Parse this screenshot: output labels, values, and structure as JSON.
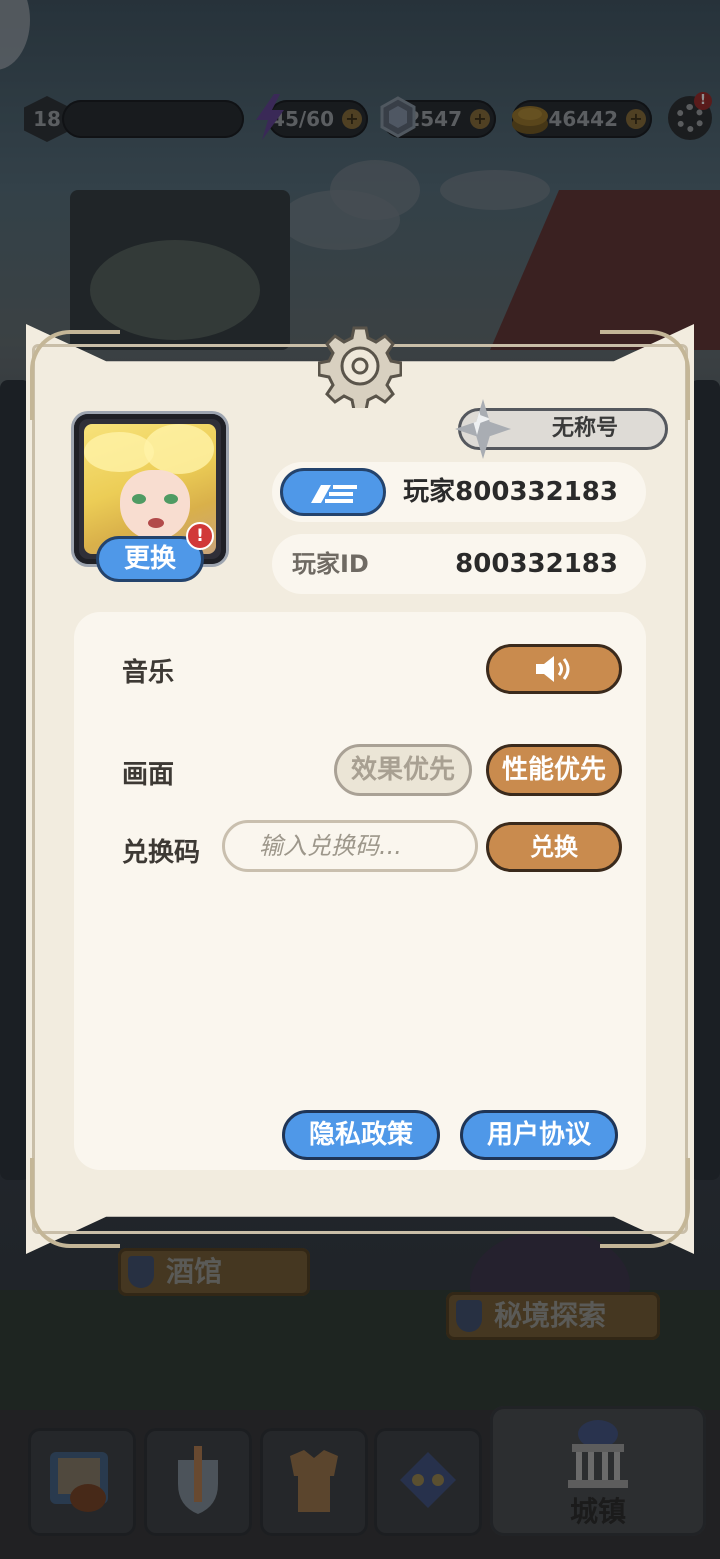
{
  "hud": {
    "level": "18",
    "energy": "45/60",
    "gems": "2547",
    "coins": "46442",
    "settings_alert": "!"
  },
  "map": {
    "tavern_label": "酒馆",
    "secret_realm_label": "秘境探索"
  },
  "panel": {
    "player_title": "无称号",
    "avatar_change_label": "更换",
    "avatar_alert": "!",
    "player_name": "玩家800332183",
    "player_id_label": "玩家ID",
    "player_id_value": "800332183",
    "music_label": "音乐",
    "graphics_label": "画面",
    "graphics_options": [
      "效果优先",
      "性能优先"
    ],
    "graphics_selected": "性能优先",
    "redeem_label": "兑换码",
    "redeem_placeholder": "输入兑换码...",
    "redeem_button": "兑换",
    "privacy_button": "隐私政策",
    "agreement_button": "用户协议"
  },
  "nav": {
    "town_label": "城镇"
  },
  "icons": [
    "level-badge-icon",
    "energy-icon",
    "gem-icon",
    "coin-icon",
    "settings-gear-icon",
    "gear-emblem-icon",
    "star-title-icon",
    "pen-icon",
    "speaker-icon",
    "shield-icon",
    "map-bag-icon",
    "sword-shield-icon",
    "armor-icon",
    "dice-icon",
    "town-hall-icon"
  ],
  "colors": {
    "accent_blue": "#4f98e8",
    "accent_brown": "#c98b4e",
    "panel_bg": "#f2ecdf",
    "alert_red": "#d13838"
  }
}
